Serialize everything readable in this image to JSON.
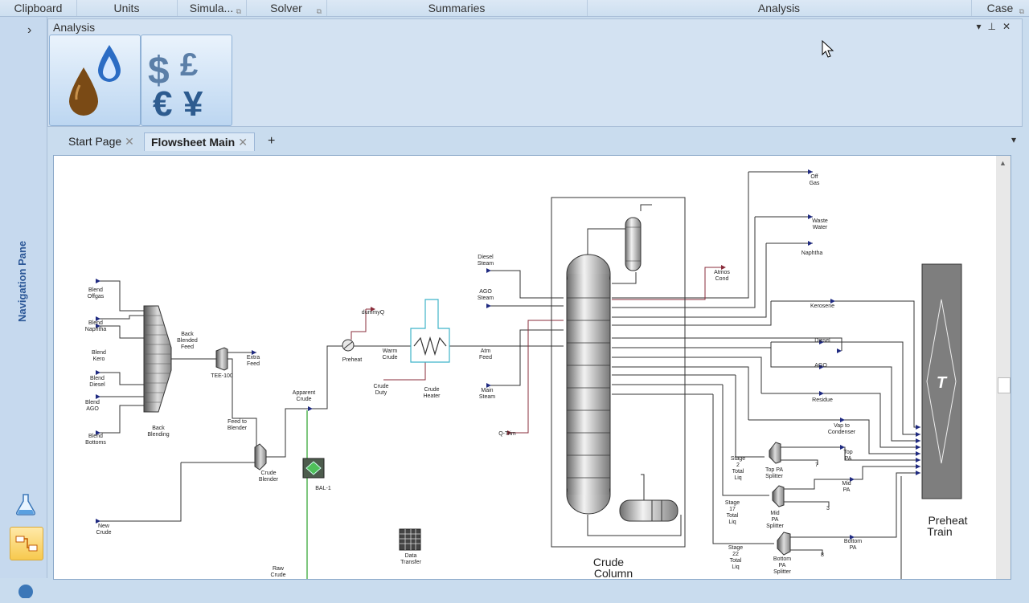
{
  "ribbon": {
    "groups": [
      "Clipboard",
      "Units",
      "Simula...",
      "Solver",
      "Summaries",
      "Analysis",
      "Case"
    ]
  },
  "nav": {
    "label": "Navigation Pane"
  },
  "analysis_panel": {
    "title": "Analysis",
    "tiles": [
      "oil-drop-icon",
      "currency-icon"
    ]
  },
  "tabs": {
    "start": "Start Page",
    "flowsheet": "Flowsheet Main",
    "add": "+"
  },
  "flowsheet": {
    "streams": {
      "blend_offgas": "Blend Offgas",
      "blend_naphtha": "Blend Naphtha",
      "blend_kero": "Blend Kero",
      "blend_diesel": "Blend Diesel",
      "blend_ago": "Blend AGO",
      "blend_bottoms": "Blend Bottoms",
      "back_blending": "Back Blending",
      "back_blended_feed": "Back Blended Feed",
      "tee100": "TEE-100",
      "extra_feed": "Extra Feed",
      "feed_to_blender": "Feed to Blender",
      "crude_blender": "Crude Blender",
      "new_crude": "New Crude",
      "apparent_crude": "Apparent Crude",
      "bal1": "BAL-1",
      "raw_crude": "Raw Crude",
      "data_transfer": "Data Transfer",
      "dummyq": "dummyQ",
      "preheat": "Preheat",
      "warm_crude": "Warm Crude",
      "crude_duty": "Crude Duty",
      "crude_heater": "Crude Heater",
      "diesel_steam": "Diesel Steam",
      "ago_steam": "AGO Steam",
      "atm_feed": "Atm Feed",
      "main_steam": "Main Steam",
      "q_trim": "Q-Trim",
      "off_gas": "Off Gas",
      "waste_water": "Waste Water",
      "naphtha": "Naphtha",
      "atmos_cond": "Atmos Cond",
      "kerosene": "Kerosene",
      "diesel": "Diesel",
      "ago": "AGO",
      "residue": "Residue",
      "vap_to_condenser": "Vap to Condenser",
      "stage2": "Stage 2 Total Liq",
      "top_pa_splitter": "Top PA Splitter",
      "top_pa": "Top PA",
      "n7": "7",
      "stage17": "Stage 17 Total Liq",
      "mid_pa_splitter": "Mid PA Splitter",
      "mid_pa": "Mid PA",
      "n3": "3",
      "stage22": "Stage 22 Total Liq",
      "bottom_pa_splitter": "Bottom PA Splitter",
      "bottom_pa": "Bottom PA",
      "n8": "8",
      "crude_column_1": "Crude",
      "crude_column_2": "Column",
      "preheat_train_1": "Preheat",
      "preheat_train_2": "Train",
      "t_label": "T"
    }
  }
}
